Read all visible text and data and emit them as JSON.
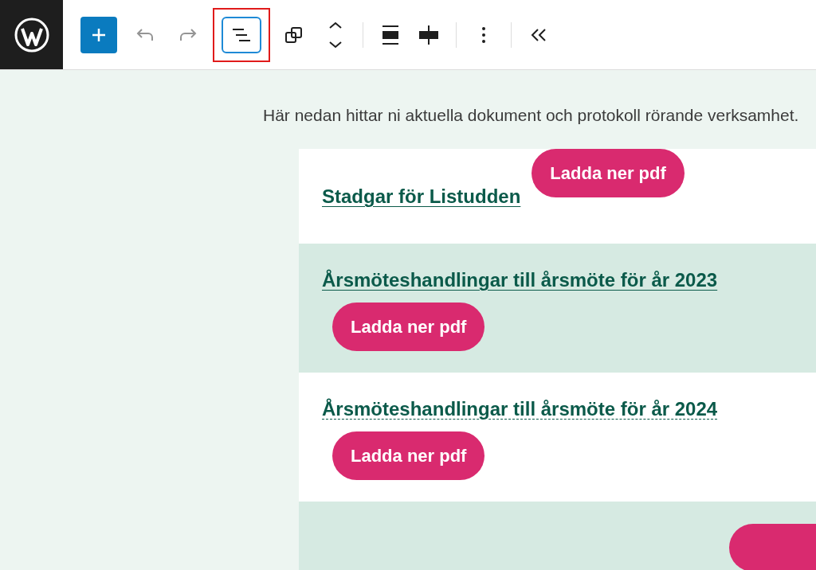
{
  "toolbar": {
    "undo_disabled": true,
    "redo_disabled": true,
    "list_view_selected": true,
    "list_view_highlighted": true
  },
  "intro": "Här nedan hittar ni aktuella dokument och protokoll rörande verksamhet.",
  "documents": [
    {
      "title": "Stadgar för Listudden",
      "button": "Ladda ner pdf",
      "shaded": false,
      "dashed_underline": false,
      "button_inline": true
    },
    {
      "title": "Årsmöteshandlingar till årsmöte för år 2023",
      "button": "Ladda ner pdf",
      "shaded": true,
      "dashed_underline": false,
      "button_inline": false
    },
    {
      "title": "Årsmöteshandlingar till årsmöte för år 2024",
      "button": "Ladda ner pdf",
      "shaded": false,
      "dashed_underline": true,
      "button_inline": false
    }
  ]
}
